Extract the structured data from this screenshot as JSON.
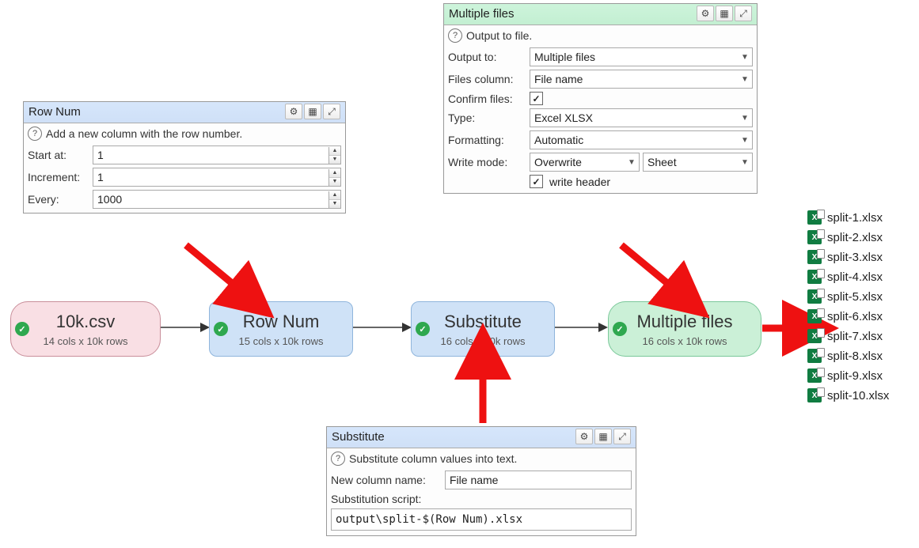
{
  "panels": {
    "rownum": {
      "title": "Row Num",
      "help": "Add a new column with the row number.",
      "labels": {
        "start": "Start at:",
        "increment": "Increment:",
        "every": "Every:"
      },
      "values": {
        "start": "1",
        "increment": "1",
        "every": "1000"
      }
    },
    "multiple": {
      "title": "Multiple files",
      "help": "Output to file.",
      "labels": {
        "output_to": "Output to:",
        "files_column": "Files column:",
        "confirm_files": "Confirm files:",
        "type": "Type:",
        "formatting": "Formatting:",
        "write_mode": "Write mode:",
        "write_header": "write header"
      },
      "values": {
        "output_to": "Multiple files",
        "files_column": "File name",
        "confirm_files": true,
        "type": "Excel XLSX",
        "formatting": "Automatic",
        "write_mode": "Overwrite",
        "write_mode_b": "Sheet",
        "write_header": true
      }
    },
    "substitute": {
      "title": "Substitute",
      "help": "Substitute column values into text.",
      "labels": {
        "new_col": "New column name:",
        "script": "Substitution script:"
      },
      "values": {
        "new_col": "File name",
        "script": "output\\split-$(Row Num).xlsx"
      }
    }
  },
  "nodes": {
    "n1": {
      "title": "10k.csv",
      "meta": "14 cols x 10k rows"
    },
    "n2": {
      "title": "Row Num",
      "meta": "15 cols x 10k rows"
    },
    "n3": {
      "title": "Substitute",
      "meta": "16 cols x 10k rows"
    },
    "n4": {
      "title": "Multiple files",
      "meta": "16 cols x 10k rows"
    }
  },
  "outputs": [
    "split-1.xlsx",
    "split-2.xlsx",
    "split-3.xlsx",
    "split-4.xlsx",
    "split-5.xlsx",
    "split-6.xlsx",
    "split-7.xlsx",
    "split-8.xlsx",
    "split-9.xlsx",
    "split-10.xlsx"
  ],
  "checkmark": "✓"
}
